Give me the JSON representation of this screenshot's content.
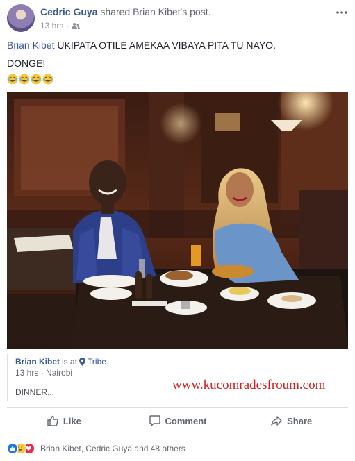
{
  "post": {
    "author": "Cedric Guya",
    "shared_text": "shared",
    "shared_target": "Brian Kibet's post.",
    "time": "13 hrs",
    "privacy_icon": "friends-icon",
    "body": {
      "mention": "Brian Kibet",
      "line1_rest": "UKIPATA OTILE AMEKAA VIBAYA PITA TU NAYO.",
      "line2": "DONGE!",
      "emojis": [
        "laughing-tears-emoji",
        "laughing-tears-emoji",
        "laughing-tears-emoji",
        "laughing-tears-emoji"
      ]
    }
  },
  "shared_post": {
    "author": "Brian Kibet",
    "is_at": "is at",
    "place": "Tribe.",
    "time": "13 hrs",
    "location": "Nairobi",
    "body": "DINNER...",
    "watermark": "www.kucomradesfroum.com"
  },
  "actions": {
    "like": "Like",
    "comment": "Comment",
    "share": "Share"
  },
  "reactions": {
    "icons": [
      "like-reaction-icon",
      "haha-reaction-icon",
      "love-reaction-icon"
    ],
    "summary": "Brian Kibet, Cedric Guya and 48 others"
  },
  "colors": {
    "link": "#385898",
    "watermark": "#d21f1f",
    "action_gray": "#606770"
  }
}
